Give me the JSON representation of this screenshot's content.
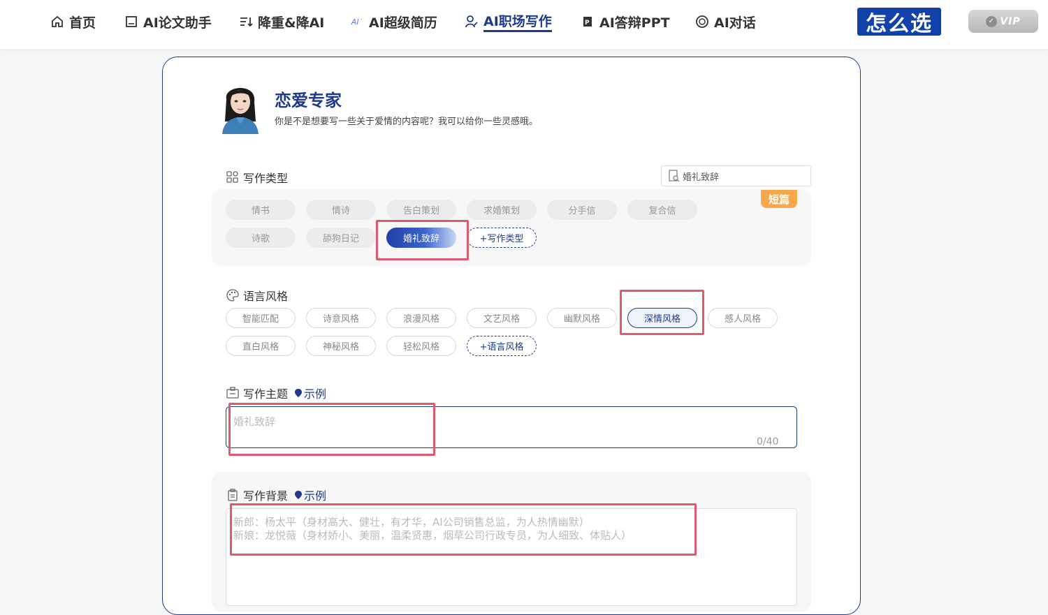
{
  "nav": {
    "items": [
      {
        "label": "首页",
        "icon": "home-icon"
      },
      {
        "label": "AI论文助手",
        "icon": "document-icon"
      },
      {
        "label": "降重&降AI",
        "icon": "sort-icon"
      },
      {
        "label": "AI超级简历",
        "icon": "ai-icon"
      },
      {
        "label": "AI职场写作",
        "icon": "user-edit-icon"
      },
      {
        "label": "AI答辩PPT",
        "icon": "ppt-icon"
      },
      {
        "label": "AI对话",
        "icon": "chat-icon"
      }
    ],
    "active_index": 4,
    "brand": "怎么选",
    "vip": "VIP"
  },
  "expert": {
    "title": "恋爱专家",
    "desc": "你是不是想要写一些关于爱情的内容呢？我可以给你一些灵感哦。"
  },
  "writing_type": {
    "label": "写作类型",
    "search_value": "婚礼致辞",
    "badge": "短篇",
    "chips": [
      "情书",
      "情诗",
      "告白策划",
      "求婚策划",
      "分手信",
      "复合信",
      "诗歌",
      "舔狗日记",
      "婚礼致辞"
    ],
    "selected": "婚礼致辞",
    "add_label": "+写作类型"
  },
  "language_style": {
    "label": "语言风格",
    "chips": [
      "智能匹配",
      "诗意风格",
      "浪漫风格",
      "文艺风格",
      "幽默风格",
      "深情风格",
      "感人风格",
      "直白风格",
      "神秘风格",
      "轻松风格"
    ],
    "selected": "深情风格",
    "add_label": "+语言风格"
  },
  "topic": {
    "label": "写作主题",
    "example": "示例",
    "placeholder": "婚礼致辞",
    "counter": "0/40"
  },
  "background": {
    "label": "写作背景",
    "example": "示例",
    "placeholder_line1": "新郎：杨太平（身材高大、健壮，有才华，AI公司销售总监，为人热情幽默）",
    "placeholder_line2": "新娘：龙悦薇（身材娇小、美丽，温柔贤惠，烟草公司行政专员，为人细致、体贴人）"
  },
  "colors": {
    "primary": "#1e3a8a",
    "brand_bg": "#1242a8",
    "highlight": "#e05a6e",
    "badge": "#f7a84b"
  }
}
